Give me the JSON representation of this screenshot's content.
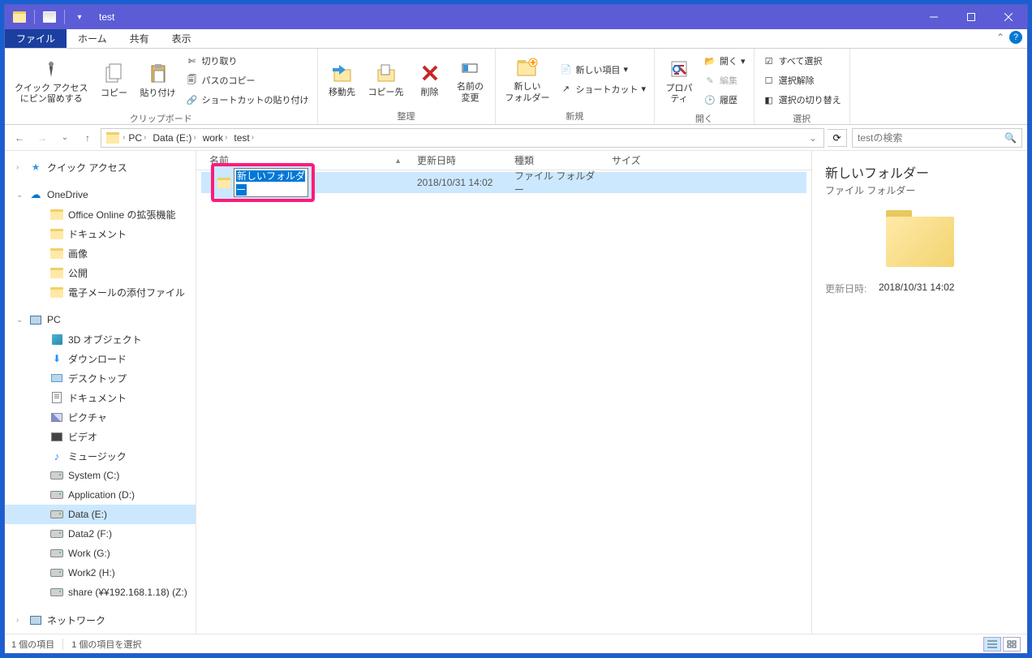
{
  "titlebar": {
    "title": "test"
  },
  "tabs": {
    "file": "ファイル",
    "home": "ホーム",
    "share": "共有",
    "view": "表示"
  },
  "ribbon": {
    "clipboard": {
      "label": "クリップボード",
      "pin": "クイック アクセス\nにピン留めする",
      "copy": "コピー",
      "paste": "貼り付け",
      "cut": "切り取り",
      "copy_path": "パスのコピー",
      "paste_shortcut": "ショートカットの貼り付け"
    },
    "organize": {
      "label": "整理",
      "move_to": "移動先",
      "copy_to": "コピー先",
      "delete": "削除",
      "rename": "名前の\n変更"
    },
    "new": {
      "label": "新規",
      "new_folder": "新しい\nフォルダー",
      "new_item": "新しい項目",
      "shortcut": "ショートカット"
    },
    "open": {
      "label": "開く",
      "properties": "プロパ\nティ",
      "open_btn": "開く",
      "edit": "編集",
      "history": "履歴"
    },
    "select": {
      "label": "選択",
      "select_all": "すべて選択",
      "select_none": "選択解除",
      "invert": "選択の切り替え"
    }
  },
  "address": {
    "crumbs": [
      "PC",
      "Data (E:)",
      "work",
      "test"
    ],
    "search_placeholder": "testの検索"
  },
  "nav": {
    "quick_access": "クイック アクセス",
    "onedrive": "OneDrive",
    "onedrive_items": [
      "Office Online の拡張機能",
      "ドキュメント",
      "画像",
      "公開",
      "電子メールの添付ファイル"
    ],
    "pc": "PC",
    "pc_items": [
      {
        "label": "3D オブジェクト",
        "icon": "threed"
      },
      {
        "label": "ダウンロード",
        "icon": "download"
      },
      {
        "label": "デスクトップ",
        "icon": "desktop"
      },
      {
        "label": "ドキュメント",
        "icon": "doc"
      },
      {
        "label": "ピクチャ",
        "icon": "image"
      },
      {
        "label": "ビデオ",
        "icon": "video"
      },
      {
        "label": "ミュージック",
        "icon": "music"
      },
      {
        "label": "System (C:)",
        "icon": "drive"
      },
      {
        "label": "Application (D:)",
        "icon": "drive"
      },
      {
        "label": "Data (E:)",
        "icon": "drive",
        "selected": true
      },
      {
        "label": "Data2 (F:)",
        "icon": "drive"
      },
      {
        "label": "Work (G:)",
        "icon": "drive"
      },
      {
        "label": "Work2 (H:)",
        "icon": "drive"
      },
      {
        "label": "share (¥¥192.168.1.18) (Z:)",
        "icon": "drive"
      }
    ],
    "network": "ネットワーク"
  },
  "columns": {
    "name": "名前",
    "date": "更新日時",
    "type": "種類",
    "size": "サイズ"
  },
  "files": [
    {
      "name": "新しいフォルダー",
      "date": "2018/10/31 14:02",
      "type": "ファイル フォルダー",
      "size": "",
      "editing": true
    }
  ],
  "details": {
    "title": "新しいフォルダー",
    "type": "ファイル フォルダー",
    "date_label": "更新日時:",
    "date_value": "2018/10/31 14:02"
  },
  "status": {
    "items": "1 個の項目",
    "selected": "1 個の項目を選択"
  }
}
